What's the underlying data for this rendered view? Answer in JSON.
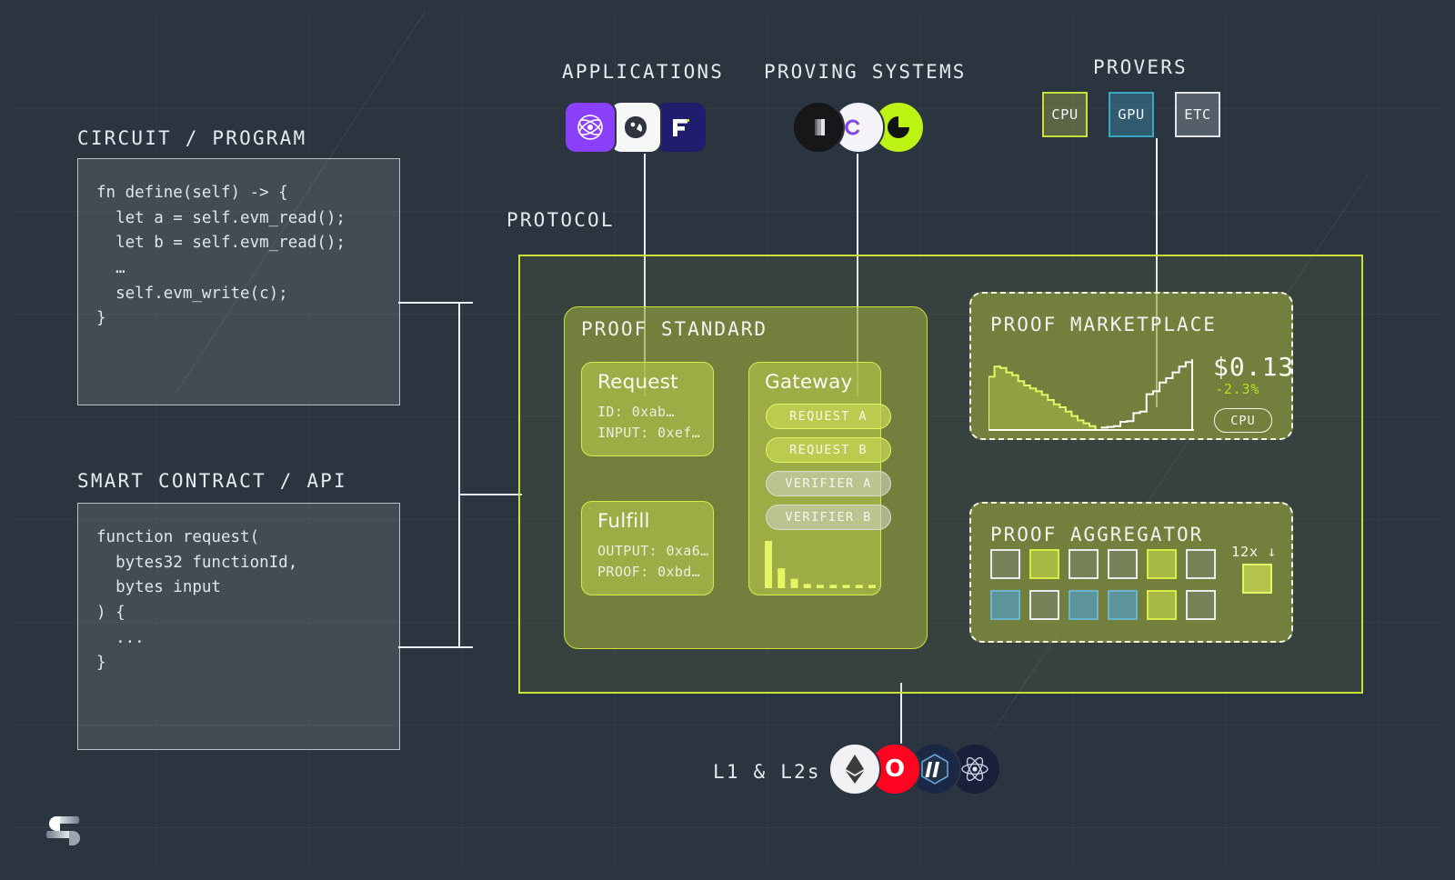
{
  "colors": {
    "background": "#2b3540",
    "accent_yellow": "#c9e038",
    "accent_bright": "#e4f663",
    "panel_olive": "#98a63c",
    "text_light": "#e7eaed",
    "gpu_cyan": "#3aa6c4",
    "delta_green": "#b8e01f"
  },
  "labels": {
    "circuit_program": "CIRCUIT / PROGRAM",
    "smart_contract": "SMART CONTRACT / API",
    "applications": "APPLICATIONS",
    "proving_systems": "PROVING SYSTEMS",
    "provers": "PROVERS",
    "protocol": "PROTOCOL",
    "l1_l2s": "L1 & L2s"
  },
  "code_circuit": "fn define(self) -> {\n  let a = self.evm_read();\n  let b = self.evm_read();\n  …\n  self.evm_write(c);\n}",
  "code_contract": "function request(\n  bytes32 functionId,\n  bytes input\n) {\n  ...\n}",
  "provers": [
    {
      "label": "CPU",
      "border": "#c9e038",
      "fill": "rgba(150,160,70,0.45)"
    },
    {
      "label": "GPU",
      "border": "#3aa6c4",
      "fill": "rgba(58,140,170,0.45)"
    },
    {
      "label": "ETC",
      "border": "#e2e6ea",
      "fill": "rgba(150,160,170,0.40)"
    }
  ],
  "proof_standard": {
    "title": "PROOF STANDARD",
    "request": {
      "heading": "Request",
      "rows": [
        "ID: 0xab…",
        "INPUT: 0xef…"
      ]
    },
    "fulfill": {
      "heading": "Fulfill",
      "rows": [
        "OUTPUT: 0xa6…",
        "PROOF: 0xbd…"
      ]
    },
    "gateway": {
      "heading": "Gateway",
      "pills": [
        {
          "label": "REQUEST A",
          "kind": "req"
        },
        {
          "label": "REQUEST B",
          "kind": "req"
        },
        {
          "label": "VERIFIER A",
          "kind": "ver"
        },
        {
          "label": "VERIFIER B",
          "kind": "ver"
        }
      ]
    }
  },
  "marketplace": {
    "title": "PROOF MARKETPLACE",
    "price": "$0.13",
    "change": "-2.3%",
    "badge": "CPU"
  },
  "aggregator": {
    "title": "PROOF AGGREGATOR",
    "multiplier": "12x",
    "squares": [
      {
        "border": "#e8ecee",
        "fill": "rgba(120,132,112,0.55)"
      },
      {
        "border": "#d8ec46",
        "fill": "rgba(176,194,70,0.85)"
      },
      {
        "border": "#e8ecee",
        "fill": "rgba(120,132,112,0.55)"
      },
      {
        "border": "#e8ecee",
        "fill": "rgba(120,132,112,0.55)"
      },
      {
        "border": "#d8ec46",
        "fill": "rgba(176,194,70,0.85)"
      },
      {
        "border": "#e8ecee",
        "fill": "rgba(120,132,112,0.55)"
      },
      {
        "border": "#6ab4cf",
        "fill": "rgba(86,152,178,0.80)"
      },
      {
        "border": "#e8ecee",
        "fill": "rgba(120,132,112,0.55)"
      },
      {
        "border": "#6ab4cf",
        "fill": "rgba(86,152,178,0.80)"
      },
      {
        "border": "#6ab4cf",
        "fill": "rgba(86,152,178,0.80)"
      },
      {
        "border": "#d8ec46",
        "fill": "rgba(176,194,70,0.85)"
      },
      {
        "border": "#e8ecee",
        "fill": "rgba(120,132,112,0.55)"
      }
    ],
    "result": {
      "border": "#e4f663",
      "fill": "rgba(186,202,78,0.9)"
    }
  },
  "chart_data": [
    {
      "type": "area",
      "title": "Proof price history",
      "name": "marketplace-sparkline",
      "series": [
        {
          "name": "filled-declining",
          "style": "area",
          "color": "#e4f663",
          "values": [
            72,
            86,
            84,
            78,
            74,
            66,
            60,
            56,
            52,
            47,
            40,
            34,
            30,
            24,
            18,
            12,
            8,
            4,
            2
          ]
        },
        {
          "name": "stepped-rising",
          "style": "line",
          "color": "#ffffff",
          "values": [
            2,
            3,
            4,
            10,
            11,
            22,
            24,
            48,
            52,
            64,
            70,
            78,
            86,
            92,
            96
          ]
        }
      ],
      "ylim": [
        0,
        100
      ],
      "grid": false,
      "legend": "none"
    },
    {
      "type": "bar",
      "title": "Gateway activity",
      "name": "gateway-bars",
      "categories": [
        "1",
        "2",
        "3",
        "4",
        "5",
        "6",
        "7",
        "8",
        "9"
      ],
      "values": [
        100,
        42,
        20,
        9,
        7,
        7,
        7,
        7,
        7
      ],
      "color": "#e4f663",
      "ylim": [
        0,
        100
      ],
      "grid": false,
      "legend": "none"
    }
  ]
}
